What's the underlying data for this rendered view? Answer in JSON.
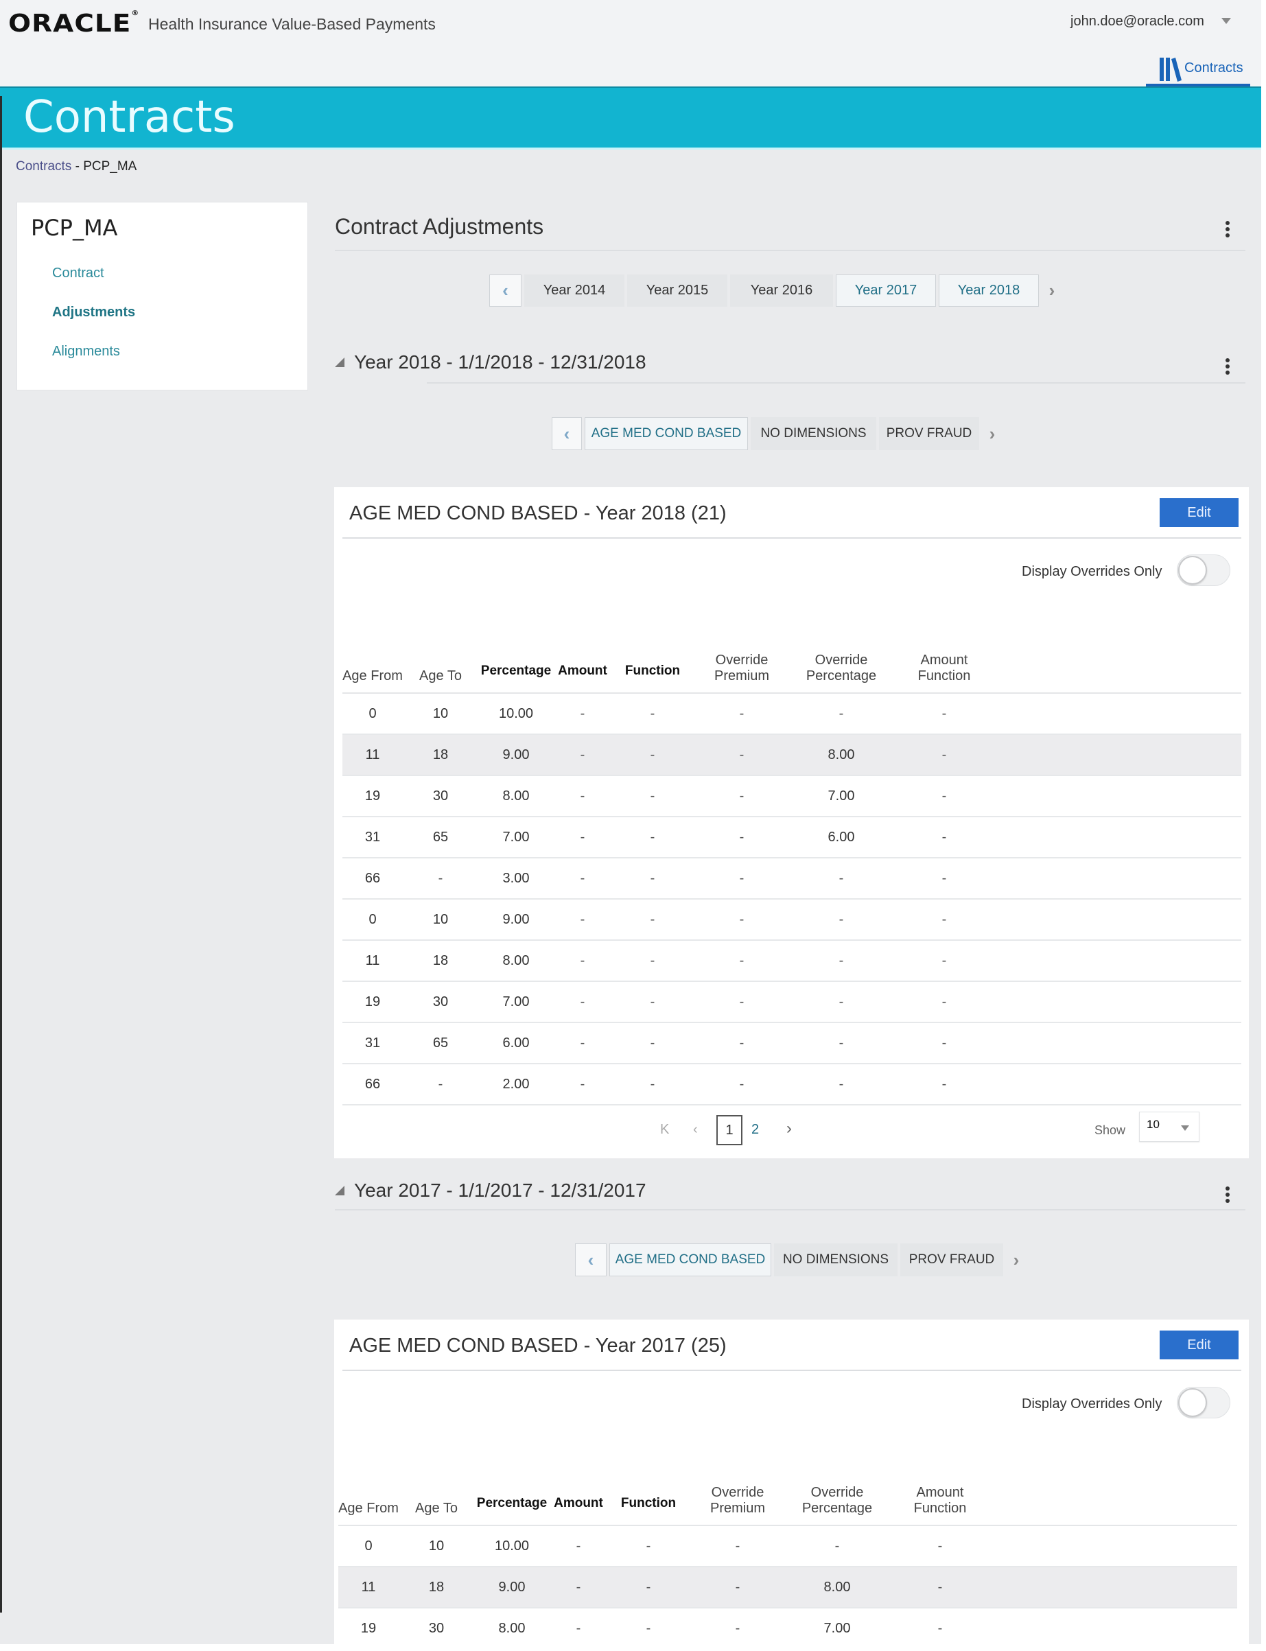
{
  "header": {
    "logo": "ORACLE",
    "app_name": "Health Insurance Value-Based Payments",
    "user": "john.doe@oracle.com",
    "nav_tab": "Contracts"
  },
  "banner": {
    "title": "Contracts"
  },
  "breadcrumb": {
    "parent": "Contracts",
    "separator": "-",
    "current": "PCP_MA"
  },
  "sidebar": {
    "title": "PCP_MA",
    "items": [
      {
        "label": "Contract",
        "active": false
      },
      {
        "label": "Adjustments",
        "active": true
      },
      {
        "label": "Alignments",
        "active": false
      }
    ]
  },
  "main": {
    "title": "Contract Adjustments",
    "year_tabs": [
      "Year 2014",
      "Year 2015",
      "Year 2016",
      "Year 2017",
      "Year 2018"
    ],
    "selected_year_tabs": [
      "Year 2017",
      "Year 2018"
    ],
    "columns": [
      "Age From",
      "Age To",
      "Percentage",
      "Amount",
      "Function",
      "Override Premium",
      "Override Percentage",
      "Amount Function"
    ],
    "sections": [
      {
        "heading": "Year 2018 - 1/1/2018 - 12/31/2018",
        "subtabs": [
          "AGE MED COND BASED",
          "NO DIMENSIONS",
          "PROV FRAUD"
        ],
        "selected_subtab": "AGE MED COND BASED",
        "card_title": "AGE MED COND BASED - Year 2018",
        "count": "(21)",
        "edit_label": "Edit",
        "toggle_label": "Display Overrides Only",
        "toggle_on": false,
        "rows": [
          [
            "0",
            "10",
            "10.00",
            "-",
            "-",
            "-",
            "-",
            "-"
          ],
          [
            "11",
            "18",
            "9.00",
            "-",
            "-",
            "-",
            "8.00",
            "-"
          ],
          [
            "19",
            "30",
            "8.00",
            "-",
            "-",
            "-",
            "7.00",
            "-"
          ],
          [
            "31",
            "65",
            "7.00",
            "-",
            "-",
            "-",
            "6.00",
            "-"
          ],
          [
            "66",
            "-",
            "3.00",
            "-",
            "-",
            "-",
            "-",
            "-"
          ],
          [
            "0",
            "10",
            "9.00",
            "-",
            "-",
            "-",
            "-",
            "-"
          ],
          [
            "11",
            "18",
            "8.00",
            "-",
            "-",
            "-",
            "-",
            "-"
          ],
          [
            "19",
            "30",
            "7.00",
            "-",
            "-",
            "-",
            "-",
            "-"
          ],
          [
            "31",
            "65",
            "6.00",
            "-",
            "-",
            "-",
            "-",
            "-"
          ],
          [
            "66",
            "-",
            "2.00",
            "-",
            "-",
            "-",
            "-",
            "-"
          ]
        ],
        "pagination": {
          "pages": [
            "1",
            "2"
          ],
          "current": "1",
          "show_label": "Show",
          "page_size": "10"
        }
      },
      {
        "heading": "Year 2017 - 1/1/2017 - 12/31/2017",
        "subtabs": [
          "AGE MED COND BASED",
          "NO DIMENSIONS",
          "PROV FRAUD"
        ],
        "selected_subtab": "AGE MED COND BASED",
        "card_title": "AGE MED COND BASED - Year 2017",
        "count": "(25)",
        "edit_label": "Edit",
        "toggle_label": "Display Overrides Only",
        "toggle_on": false,
        "rows": [
          [
            "0",
            "10",
            "10.00",
            "-",
            "-",
            "-",
            "-",
            "-"
          ],
          [
            "11",
            "18",
            "9.00",
            "-",
            "-",
            "-",
            "8.00",
            "-"
          ],
          [
            "19",
            "30",
            "8.00",
            "-",
            "-",
            "-",
            "7.00",
            "-"
          ]
        ]
      }
    ]
  },
  "icons": {
    "user_menu": "caret-down-icon",
    "nav_tab": "books-icon",
    "more": "kebab-menu-icon",
    "collapse": "collapse-triangle-icon",
    "prev": "chevron-left-icon",
    "next": "chevron-right-icon",
    "first": "first-page-icon"
  },
  "colors": {
    "banner": "#12b4d0",
    "accent_blue": "#1a64b8",
    "edit_button": "#2a6fcc",
    "link_teal": "#2a8a9a",
    "page_bg": "#eaebed"
  }
}
